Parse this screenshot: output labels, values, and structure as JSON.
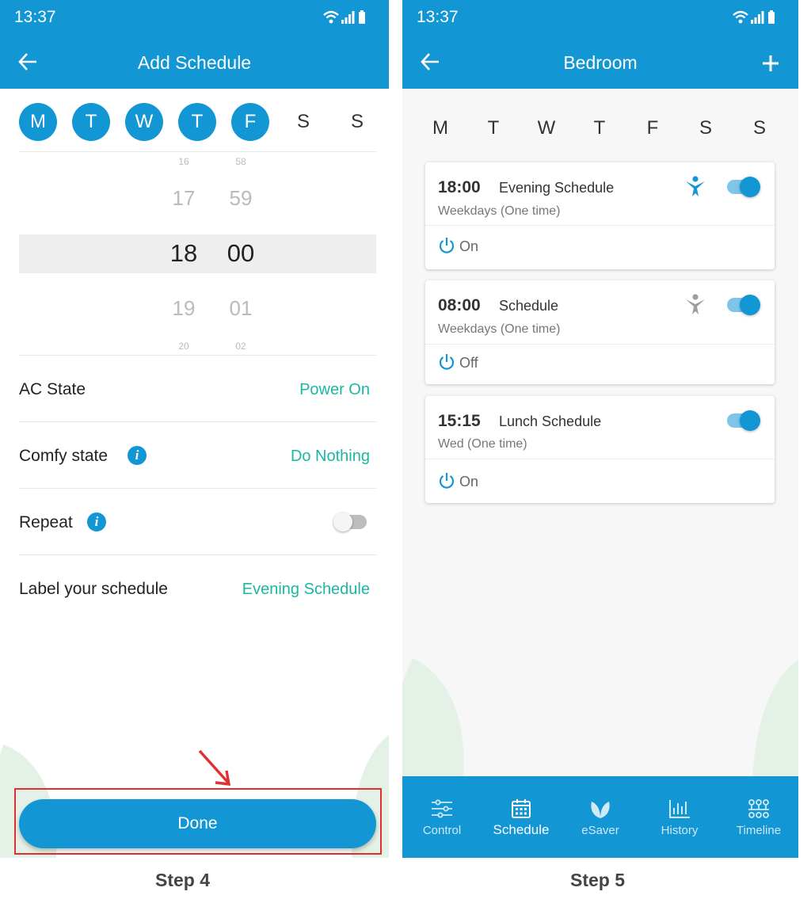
{
  "step4": {
    "status_time": "13:37",
    "title": "Add Schedule",
    "days": [
      {
        "letter": "M",
        "selected": true
      },
      {
        "letter": "T",
        "selected": true
      },
      {
        "letter": "W",
        "selected": true
      },
      {
        "letter": "T",
        "selected": true
      },
      {
        "letter": "F",
        "selected": true
      },
      {
        "letter": "S",
        "selected": false
      },
      {
        "letter": "S",
        "selected": false
      }
    ],
    "picker": {
      "hours": [
        "16",
        "17",
        "18",
        "19",
        "20"
      ],
      "minutes": [
        "58",
        "59",
        "00",
        "01",
        "02"
      ]
    },
    "rows": {
      "ac_state_label": "AC State",
      "ac_state_value": "Power On",
      "comfy_label": "Comfy state",
      "comfy_value": "Do Nothing",
      "repeat_label": "Repeat",
      "label_label": "Label your schedule",
      "label_value": "Evening Schedule"
    },
    "done_label": "Done",
    "caption": "Step 4"
  },
  "step5": {
    "status_time": "13:37",
    "title": "Bedroom",
    "days": [
      "M",
      "T",
      "W",
      "T",
      "F",
      "S",
      "S"
    ],
    "schedules": [
      {
        "time": "18:00",
        "name": "Evening Schedule",
        "sub": "Weekdays (One time)",
        "state": "On",
        "enabled": true,
        "comfy": "active"
      },
      {
        "time": "08:00",
        "name": "Schedule",
        "sub": "Weekdays (One time)",
        "state": "Off",
        "enabled": true,
        "comfy": "inactive"
      },
      {
        "time": "15:15",
        "name": "Lunch Schedule",
        "sub": "Wed (One time)",
        "state": "On",
        "enabled": true,
        "comfy": "none"
      }
    ],
    "nav": [
      {
        "label": "Control",
        "icon": "sliders-icon"
      },
      {
        "label": "Schedule",
        "icon": "calendar-icon"
      },
      {
        "label": "eSaver",
        "icon": "leaf-icon"
      },
      {
        "label": "History",
        "icon": "bar-chart-icon"
      },
      {
        "label": "Timeline",
        "icon": "timeline-icon"
      }
    ],
    "nav_active": "Schedule",
    "caption": "Step 5"
  },
  "colors": {
    "primary": "#1296d4",
    "teal_value": "#1bb6a4",
    "highlight_red": "#e03030"
  }
}
